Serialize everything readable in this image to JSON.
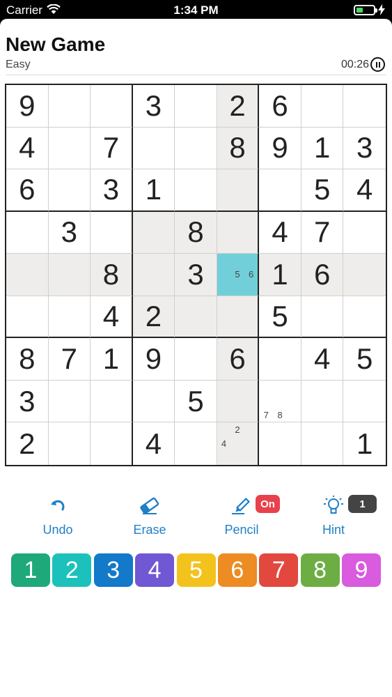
{
  "status_bar": {
    "carrier": "Carrier",
    "time": "1:34 PM",
    "battery_level": 0.4
  },
  "header": {
    "title": "New Game",
    "difficulty": "Easy",
    "timer": "00:26"
  },
  "board": {
    "cells": [
      [
        "9",
        "",
        "",
        "3",
        "",
        "2",
        "6",
        "",
        ""
      ],
      [
        "4",
        "",
        "7",
        "",
        "",
        "8",
        "9",
        "1",
        "3"
      ],
      [
        "6",
        "",
        "3",
        "1",
        "",
        "",
        "",
        "5",
        "4"
      ],
      [
        "",
        "3",
        "",
        "",
        "8",
        "",
        "4",
        "7",
        ""
      ],
      [
        "",
        "",
        "8",
        "",
        "3",
        "",
        "1",
        "6",
        ""
      ],
      [
        "",
        "",
        "4",
        "2",
        "",
        "",
        "5",
        "",
        ""
      ],
      [
        "8",
        "7",
        "1",
        "9",
        "",
        "6",
        "",
        "4",
        "5"
      ],
      [
        "3",
        "",
        "",
        "",
        "5",
        "",
        "",
        "",
        ""
      ],
      [
        "2",
        "",
        "",
        "4",
        "",
        "",
        "",
        "",
        "1"
      ]
    ],
    "notes": [
      {
        "row": 4,
        "col": 5,
        "values": [
          "5",
          "6"
        ]
      },
      {
        "row": 7,
        "col": 6,
        "values": [
          "7",
          "8"
        ]
      },
      {
        "row": 8,
        "col": 5,
        "values": [
          "2",
          "4"
        ]
      }
    ],
    "selected": {
      "row": 4,
      "col": 5
    },
    "colors": {
      "highlight": "#efedeb",
      "selected": "#71cfda"
    }
  },
  "toolbar": {
    "undo_label": "Undo",
    "erase_label": "Erase",
    "pencil_label": "Pencil",
    "pencil_state": "On",
    "hint_label": "Hint",
    "hint_count": "1",
    "accent": "#1f7fc7"
  },
  "numpad": [
    {
      "label": "1",
      "color": "#1fa97a"
    },
    {
      "label": "2",
      "color": "#1cc1bb"
    },
    {
      "label": "3",
      "color": "#1379c9"
    },
    {
      "label": "4",
      "color": "#7057d3"
    },
    {
      "label": "5",
      "color": "#f4c21c"
    },
    {
      "label": "6",
      "color": "#ec8c22"
    },
    {
      "label": "7",
      "color": "#e2483e"
    },
    {
      "label": "8",
      "color": "#6ead43"
    },
    {
      "label": "9",
      "color": "#d95bde"
    }
  ]
}
